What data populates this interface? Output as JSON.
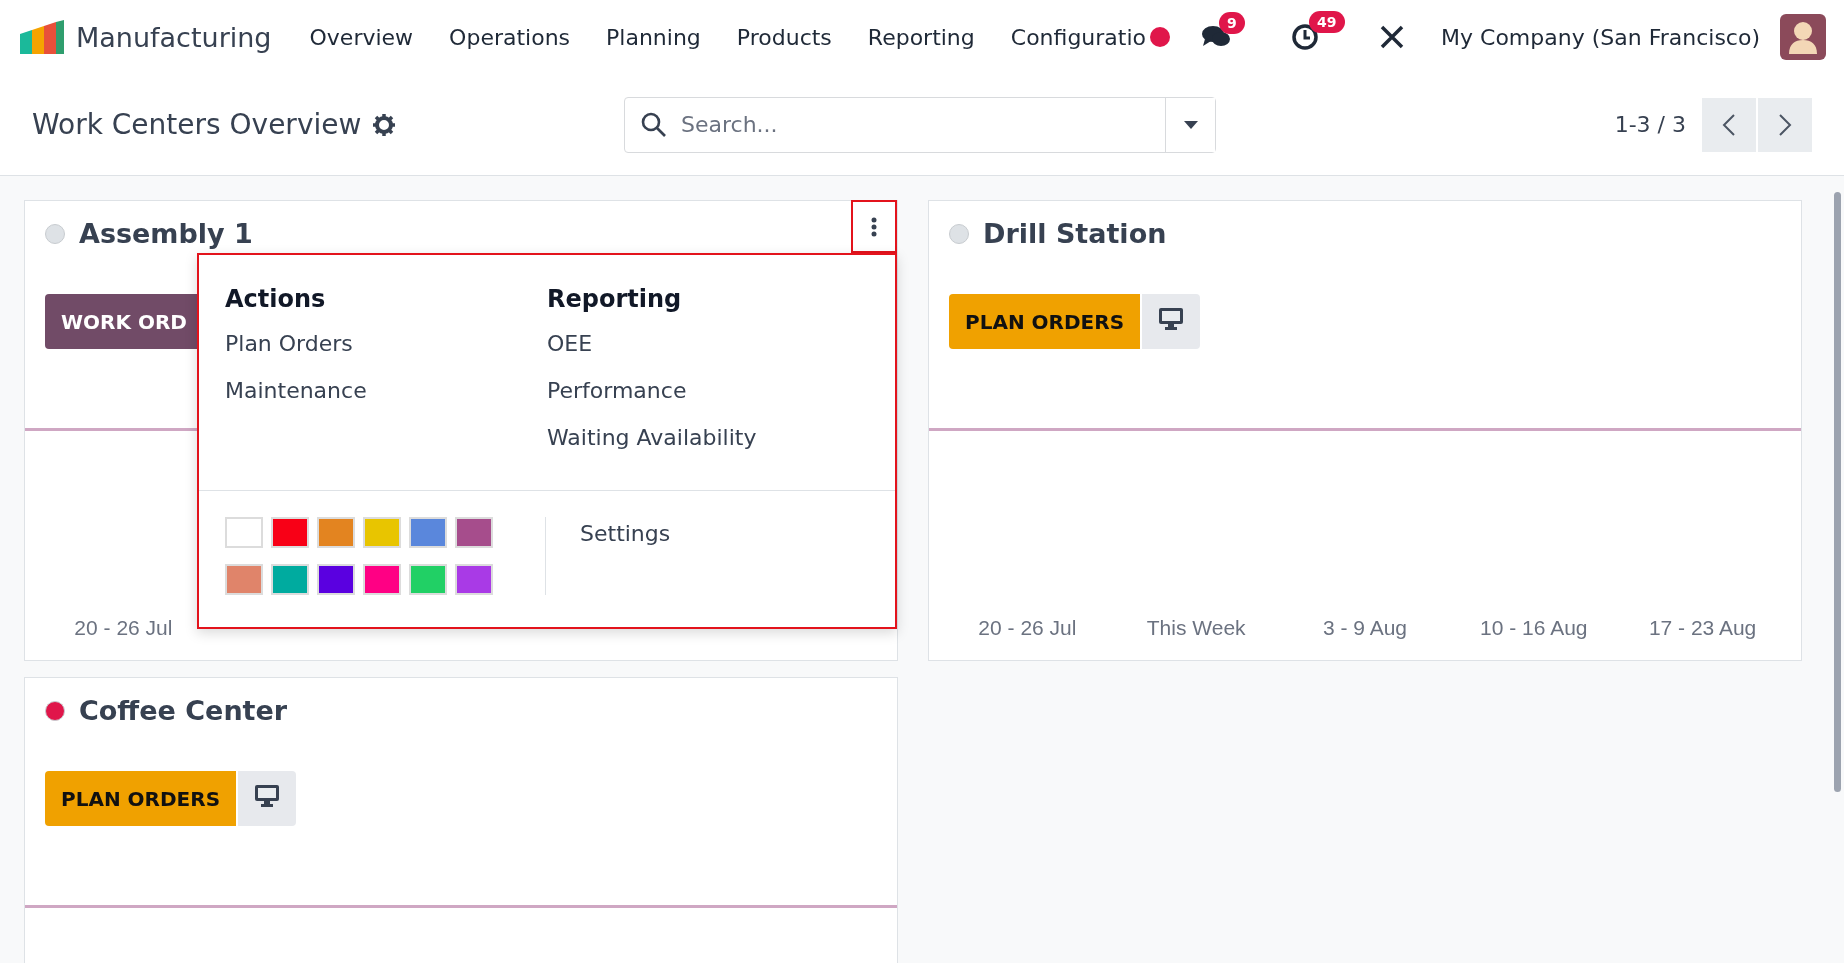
{
  "navbar": {
    "app_name": "Manufacturing",
    "menu": [
      "Overview",
      "Operations",
      "Planning",
      "Products",
      "Reporting",
      "Configuratio"
    ],
    "messages_badge": "9",
    "activities_badge": "49",
    "company": "My Company (San Francisco)"
  },
  "control_panel": {
    "title": "Work Centers Overview",
    "search": {
      "placeholder": "Search..."
    },
    "pager": "1-3 / 3"
  },
  "cards": [
    {
      "title": "Assembly 1",
      "color": "#dee2e6",
      "buttons": [
        {
          "kind": "work_orders",
          "label": "WORK ORD"
        }
      ],
      "axis_labels": [
        "20 - 26 Jul"
      ],
      "menu": {
        "sections": [
          {
            "heading": "Actions",
            "items": [
              "Plan Orders",
              "Maintenance"
            ]
          },
          {
            "heading": "Reporting",
            "items": [
              "OEE",
              "Performance",
              "Waiting Availability"
            ]
          }
        ],
        "colors": [
          {
            "color": "#ffffff"
          },
          {
            "color": "#f80016"
          },
          {
            "color": "#e38420"
          },
          {
            "color": "#e8c500"
          },
          {
            "color": "#5a87dc"
          },
          {
            "color": "#a64d8c"
          },
          {
            "color": "#e0846a"
          },
          {
            "color": "#00ab9f"
          },
          {
            "color": "#5a00e0"
          },
          {
            "color": "#ff0084"
          },
          {
            "color": "#21d065"
          },
          {
            "color": "#a93ae6"
          }
        ],
        "settings": "Settings"
      }
    },
    {
      "title": "Drill Station",
      "color": "#dee2e6",
      "buttons": [
        {
          "kind": "plan_orders",
          "label": "PLAN ORDERS"
        },
        {
          "kind": "monitor"
        }
      ],
      "axis_labels": [
        "20 - 26 Jul",
        "This Week",
        "3 - 9 Aug",
        "10 - 16 Aug",
        "17 - 23 Aug"
      ]
    },
    {
      "title": "Coffee Center",
      "color": "#e0164a",
      "buttons": [
        {
          "kind": "plan_orders",
          "label": "PLAN ORDERS"
        },
        {
          "kind": "monitor"
        }
      ]
    }
  ]
}
